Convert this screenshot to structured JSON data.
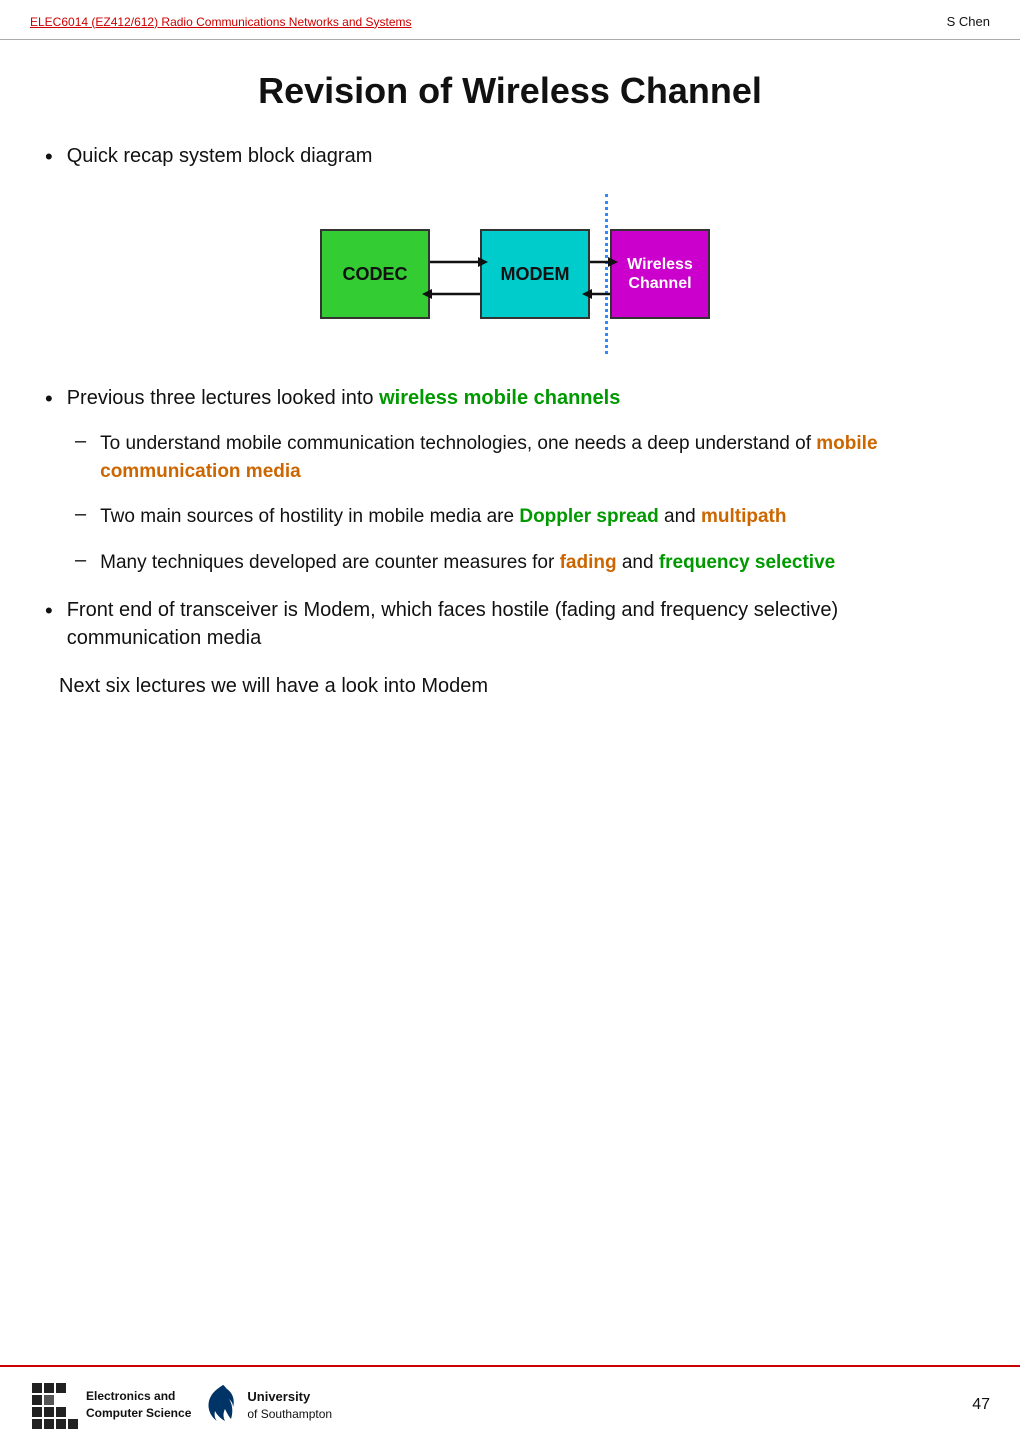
{
  "header": {
    "left_text": "ELEC6014 (EZ412/612) Radio Communications Networks and Systems",
    "right_text": "S Chen"
  },
  "title": "Revision of Wireless Channel",
  "bullets": [
    {
      "id": "bullet1",
      "text": "Quick recap system block diagram"
    },
    {
      "id": "bullet2",
      "prefix": "Previous three lectures looked into ",
      "highlight": "wireless mobile channels",
      "highlight_color": "#009900"
    },
    {
      "id": "bullet3",
      "prefix": "Front end of transceiver is Modem, which faces hostile (fading and frequency selective) communication media"
    }
  ],
  "sub_bullets": [
    {
      "id": "sub1",
      "prefix": "To understand mobile communication technologies, one needs a deep understand of ",
      "highlight": "mobile communication media",
      "highlight_color": "#cc6600"
    },
    {
      "id": "sub2",
      "prefix": "Two main sources of hostility in mobile media are ",
      "highlight1": "Doppler spread",
      "highlight1_color": "#009900",
      "mid": " and ",
      "highlight2": "multipath",
      "highlight2_color": "#cc6600"
    },
    {
      "id": "sub3",
      "prefix": "Many techniques developed are counter measures for ",
      "highlight1": "fading",
      "highlight1_color": "#cc6600",
      "mid": " and ",
      "highlight2": "frequency selective",
      "highlight2_color": "#009900"
    }
  ],
  "diagram": {
    "codec_label": "CODEC",
    "modem_label": "MODEM",
    "wireless_line1": "Wireless",
    "wireless_line2": "Channel"
  },
  "next_line": "Next six lectures we will have a look into Modem",
  "footer": {
    "ecs_line1": "Electronics and",
    "ecs_line2": "Computer Science",
    "soton_line1": "University",
    "soton_line2": "of Southampton",
    "page_number": "47"
  }
}
